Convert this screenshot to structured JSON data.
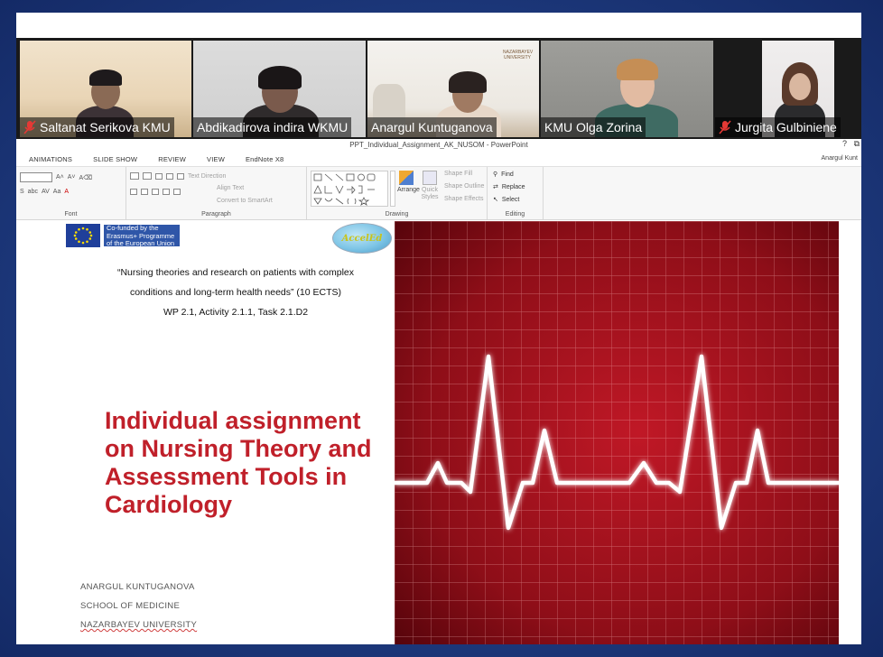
{
  "video_call": {
    "participants": [
      {
        "name": "Saltanat Serikova KMU",
        "muted": true,
        "active": false
      },
      {
        "name": "Abdikadirova indira WKMU",
        "muted": false,
        "active": false
      },
      {
        "name": "Anargul Kuntuganova",
        "muted": false,
        "active": false
      },
      {
        "name": "KMU Olga Zorina",
        "muted": false,
        "active": true
      },
      {
        "name": "Jurgita Gulbiniene",
        "muted": true,
        "active": false
      }
    ],
    "background_sign": "NAZARBAYEV UNIVERSITY"
  },
  "powerpoint": {
    "window_title": "PPT_Individual_Assignment_AK_NUSOM - PowerPoint",
    "window_buttons": [
      "?",
      "⧉"
    ],
    "user": "Anargul Kunt",
    "tabs": [
      "ANIMATIONS",
      "SLIDE SHOW",
      "REVIEW",
      "VIEW",
      "EndNote X8"
    ],
    "ribbon": {
      "font_label": "Font",
      "paragraph_label": "Paragraph",
      "drawing_label": "Drawing",
      "editing_label": "Editing",
      "text_direction": "Text Direction",
      "align_text": "Align Text",
      "convert_smartart": "Convert to SmartArt",
      "arrange": "Arrange",
      "quick_styles": "Quick Styles",
      "shape_fill": "Shape Fill",
      "shape_outline": "Shape Outline",
      "shape_effects": "Shape Effects",
      "find": "Find",
      "replace": "Replace",
      "select": "Select"
    },
    "slide": {
      "eu_funding": "Co-funded by the Erasmus+ Programme of the European Union",
      "logo_text": "AccelEd",
      "project_line1": "“Nursing theories and research on patients with complex",
      "project_line2": "conditions and long-term health needs”",
      "project_ects": "(10 ECTS)",
      "project_wp": "WP 2.1, Activity 2.1.1, Task 2.1.D2",
      "title": "Individual assignment on Nursing Theory and Assessment Tools in Cardiology",
      "author": "ANARGUL KUNTUGANOVA",
      "school": "SCHOOL OF MEDICINE",
      "university": "NAZARBAYEV UNIVERSITY"
    }
  },
  "colors": {
    "title_red": "#c0202a",
    "ecg_background": "#8e0e18",
    "active_speaker_border": "#8bc34a",
    "desktop_blue": "#213f86"
  }
}
